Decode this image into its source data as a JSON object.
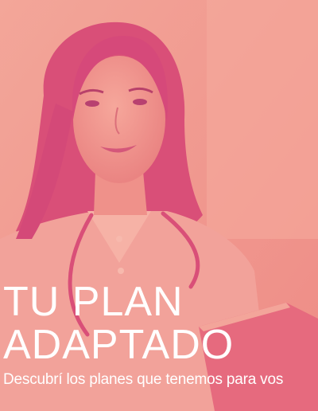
{
  "banner": {
    "headline_line1": "TU PLAN",
    "headline_line2": "ADAPTADO",
    "subtitle": "Descubrí los planes que tenemos para vos"
  },
  "photo": {
    "subject": "doctor-photo"
  },
  "colors": {
    "overlay": "#f0958d",
    "deep": "#e0607a",
    "text": "#ffffff"
  }
}
